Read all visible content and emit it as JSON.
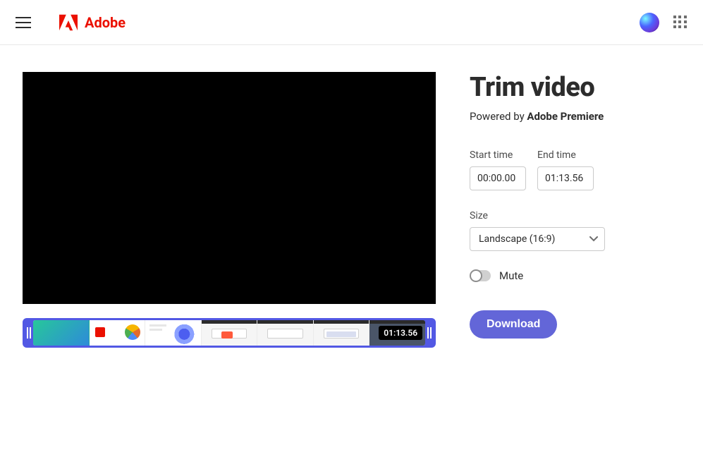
{
  "header": {
    "brand_name": "Adobe"
  },
  "page": {
    "title": "Trim video",
    "powered_by_prefix": "Powered by ",
    "powered_by_product": "Adobe Premiere"
  },
  "trim": {
    "start_label": "Start time",
    "start_value": "00:00.00",
    "end_label": "End time",
    "end_value": "01:13.56"
  },
  "size": {
    "label": "Size",
    "selected": "Landscape (16:9)"
  },
  "mute": {
    "label": "Mute",
    "on": false
  },
  "buttons": {
    "download": "Download"
  },
  "timeline": {
    "duration_badge": "01:13.56"
  }
}
